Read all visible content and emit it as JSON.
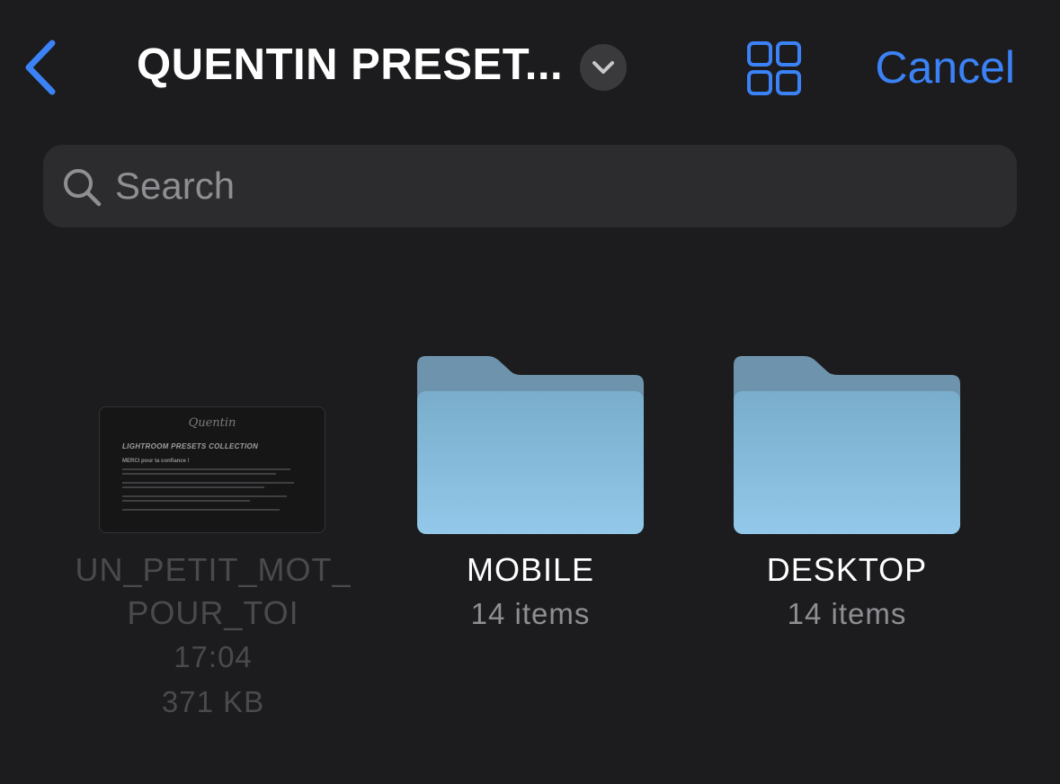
{
  "header": {
    "title": "QUENTIN PRESET...",
    "cancel_label": "Cancel"
  },
  "search": {
    "placeholder": "Search",
    "value": ""
  },
  "colors": {
    "accent": "#3b82f6",
    "background": "#1c1c1e",
    "search_background": "#2c2c2e",
    "folder_top": "#6e93ac",
    "folder_front": "#8cc1e3"
  },
  "items": [
    {
      "name": "UN_PETIT_MOT_\nPOUR_TOI",
      "time": "17:04",
      "size": "371 KB",
      "thumb": {
        "signature": "Quentin",
        "heading": "LIGHTROOM PRESETS COLLECTION",
        "subheading": "MERCI pour ta confiance !"
      }
    },
    {
      "name": "MOBILE",
      "meta": "14 items"
    },
    {
      "name": "DESKTOP",
      "meta": "14 items"
    }
  ]
}
